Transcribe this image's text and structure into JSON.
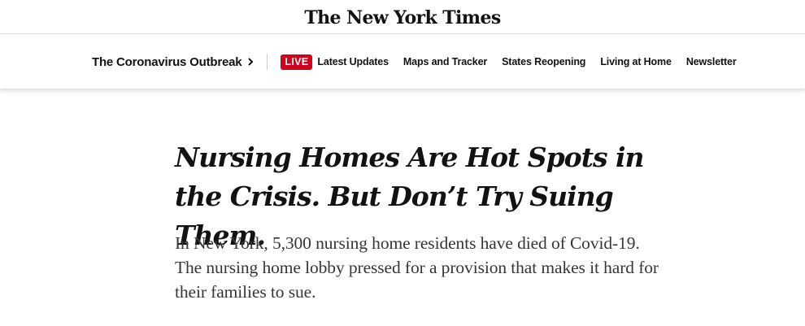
{
  "masthead": {
    "logo_text": "The New York Times"
  },
  "section_nav": {
    "section_title": "The Coronavirus Outbreak",
    "live_badge": "LIVE",
    "links": [
      "Latest Updates",
      "Maps and Tracker",
      "States Reopening",
      "Living at Home",
      "Newsletter"
    ]
  },
  "article": {
    "headline": "Nursing Homes Are Hot Spots in the Crisis. But Don’t Try Suing Them.",
    "summary": "In New York, 5,300 nursing home residents have died of Covid-19. The nursing home lobby pressed for a provision that makes it hard for their families to sue."
  },
  "colors": {
    "live_badge": "#d0021b",
    "text": "#121212",
    "summary_text": "#363636"
  }
}
